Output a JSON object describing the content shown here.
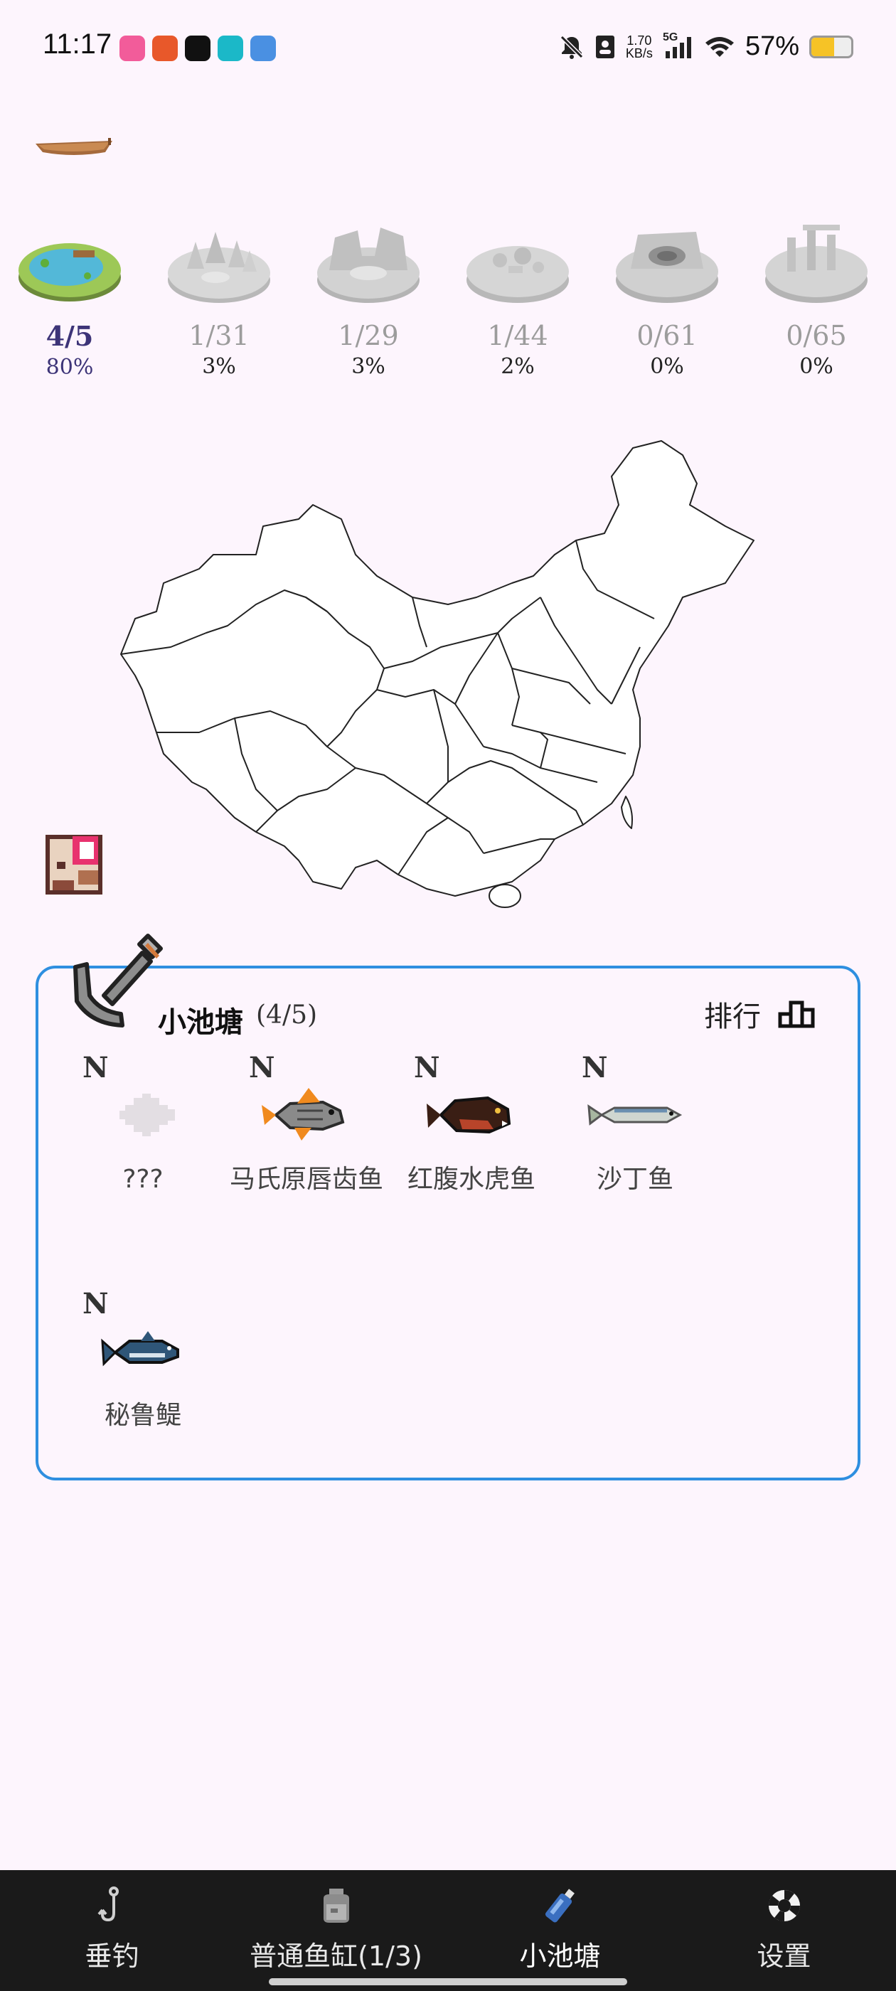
{
  "status_bar": {
    "time": "11:17",
    "speed_top": "1.70",
    "speed_bottom": "KB/s",
    "network": "5G",
    "battery_text": "57%",
    "battery_level": 0.57,
    "app_icons": [
      "bilibili-icon",
      "tomato-icon",
      "fanqie-icon",
      "music-icon",
      "photo-icon"
    ]
  },
  "ponds": [
    {
      "count": "4/5",
      "percent": "80%",
      "active": true
    },
    {
      "count": "1/31",
      "percent": "3%",
      "active": false
    },
    {
      "count": "1/29",
      "percent": "3%",
      "active": false
    },
    {
      "count": "1/44",
      "percent": "2%",
      "active": false
    },
    {
      "count": "0/61",
      "percent": "0%",
      "active": false
    },
    {
      "count": "0/65",
      "percent": "0%",
      "active": false
    }
  ],
  "card": {
    "title": "小池塘",
    "count": "(4/5)",
    "rank_label": "排行",
    "fish": [
      {
        "rarity": "N",
        "name": "???",
        "icon": "unknown-fish-icon"
      },
      {
        "rarity": "N",
        "name": "马氏原唇齿鱼",
        "icon": "orange-fish-icon"
      },
      {
        "rarity": "N",
        "name": "红腹水虎鱼",
        "icon": "piranha-icon"
      },
      {
        "rarity": "N",
        "name": "沙丁鱼",
        "icon": "sardine-icon"
      },
      {
        "rarity": "N",
        "name": "秘鲁鳀",
        "icon": "anchovy-icon"
      }
    ]
  },
  "nav": [
    {
      "label": "垂钓",
      "icon": "fishing-hook-icon",
      "active": false
    },
    {
      "label": "普通鱼缸(1/3)",
      "icon": "fish-tank-icon",
      "active": false
    },
    {
      "label": "小池塘",
      "icon": "bottle-icon",
      "active": true
    },
    {
      "label": "设置",
      "icon": "lifebuoy-icon",
      "active": false
    }
  ],
  "colors": {
    "background": "#fdf5fd",
    "card_border": "#2e8fe0",
    "active_pond": "#3d3478",
    "nav_background": "#1a1a1a",
    "battery_fill": "#f6c326"
  }
}
